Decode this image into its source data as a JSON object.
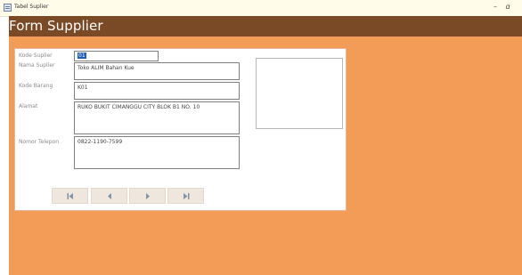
{
  "window": {
    "title": "Tabel Suplier"
  },
  "header": {
    "title": "Form Supplier"
  },
  "form": {
    "kode_suplier": {
      "label": "Kode Suplier",
      "value": "01"
    },
    "nama_suplier": {
      "label": "Nama Suplier",
      "value": "Toko ALIM Bahan Kue"
    },
    "kode_barang": {
      "label": "Kode Barang",
      "value": "K01"
    },
    "alamat": {
      "label": "Alamat",
      "value": "RUKO BUKIT CIMANGGU CITY BLOK B1 NO. 10"
    },
    "nomor_telepon": {
      "label": "Nomor Telepon",
      "value": "0822-1190-7599"
    }
  },
  "navigation": {
    "first_icon": "first-record-icon",
    "prev_icon": "previous-record-icon",
    "next_icon": "next-record-icon",
    "last_icon": "last-record-icon"
  },
  "colors": {
    "title_bar_bg": "#fffcea",
    "header_bg": "#7a4a27",
    "content_bg": "#f39c58",
    "panel_bg": "#ffffff",
    "nav_button_bg": "#efe7dd",
    "nav_icon": "#7e92a8",
    "selection": "#1f5fb8"
  }
}
